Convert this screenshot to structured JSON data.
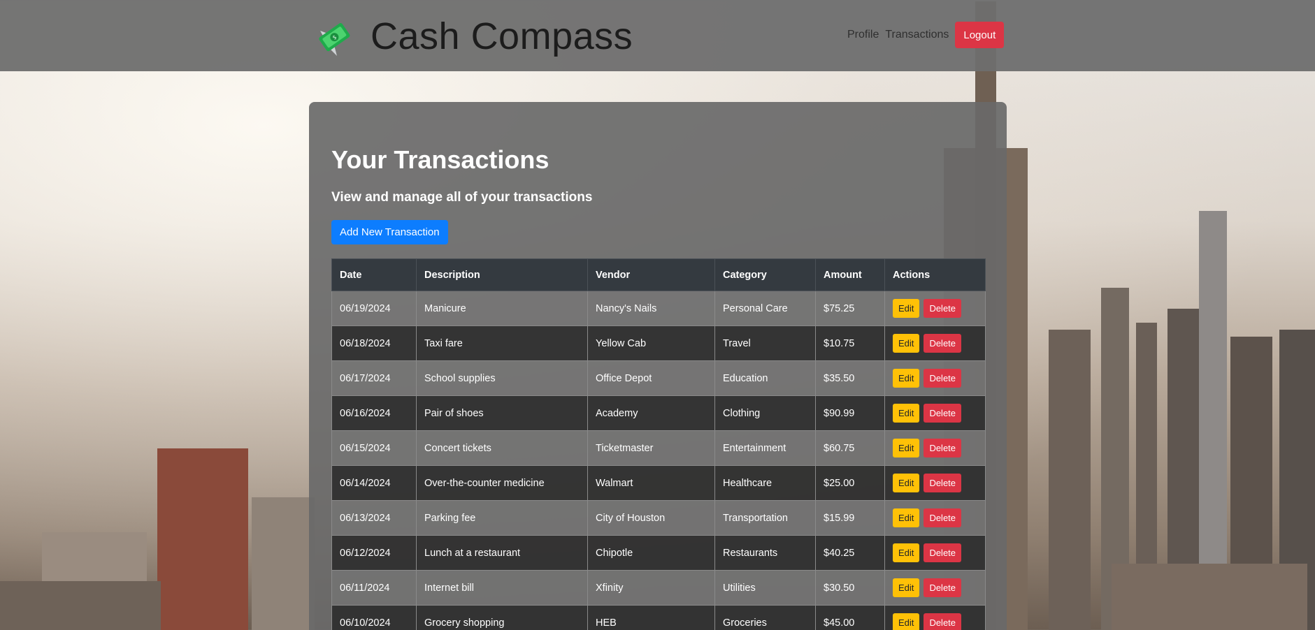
{
  "header": {
    "brand": "Cash Compass",
    "logo_icon": "money-bill-icon",
    "nav": [
      {
        "label": "Profile"
      },
      {
        "label": "Transactions"
      }
    ],
    "logout_label": "Logout"
  },
  "main": {
    "title": "Your Transactions",
    "subtitle": "View and manage all of your transactions",
    "add_button_label": "Add New Transaction",
    "table": {
      "columns": [
        "Date",
        "Description",
        "Vendor",
        "Category",
        "Amount",
        "Actions"
      ],
      "rows": [
        {
          "date": "06/19/2024",
          "description": "Manicure",
          "vendor": "Nancy's Nails",
          "category": "Personal Care",
          "amount": "$75.25"
        },
        {
          "date": "06/18/2024",
          "description": "Taxi fare",
          "vendor": "Yellow Cab",
          "category": "Travel",
          "amount": "$10.75"
        },
        {
          "date": "06/17/2024",
          "description": "School supplies",
          "vendor": "Office Depot",
          "category": "Education",
          "amount": "$35.50"
        },
        {
          "date": "06/16/2024",
          "description": "Pair of shoes",
          "vendor": "Academy",
          "category": "Clothing",
          "amount": "$90.99"
        },
        {
          "date": "06/15/2024",
          "description": "Concert tickets",
          "vendor": "Ticketmaster",
          "category": "Entertainment",
          "amount": "$60.75"
        },
        {
          "date": "06/14/2024",
          "description": "Over-the-counter medicine",
          "vendor": "Walmart",
          "category": "Healthcare",
          "amount": "$25.00"
        },
        {
          "date": "06/13/2024",
          "description": "Parking fee",
          "vendor": "City of Houston",
          "category": "Transportation",
          "amount": "$15.99"
        },
        {
          "date": "06/12/2024",
          "description": "Lunch at a restaurant",
          "vendor": "Chipotle",
          "category": "Restaurants",
          "amount": "$40.25"
        },
        {
          "date": "06/11/2024",
          "description": "Internet bill",
          "vendor": "Xfinity",
          "category": "Utilities",
          "amount": "$30.50"
        },
        {
          "date": "06/10/2024",
          "description": "Grocery shopping",
          "vendor": "HEB",
          "category": "Groceries",
          "amount": "$45.00"
        }
      ],
      "edit_label": "Edit",
      "delete_label": "Delete"
    }
  },
  "colors": {
    "primary": "#0d7dfe",
    "danger": "#dc3545",
    "warning": "#ffc107",
    "table_header": "#343a40"
  }
}
